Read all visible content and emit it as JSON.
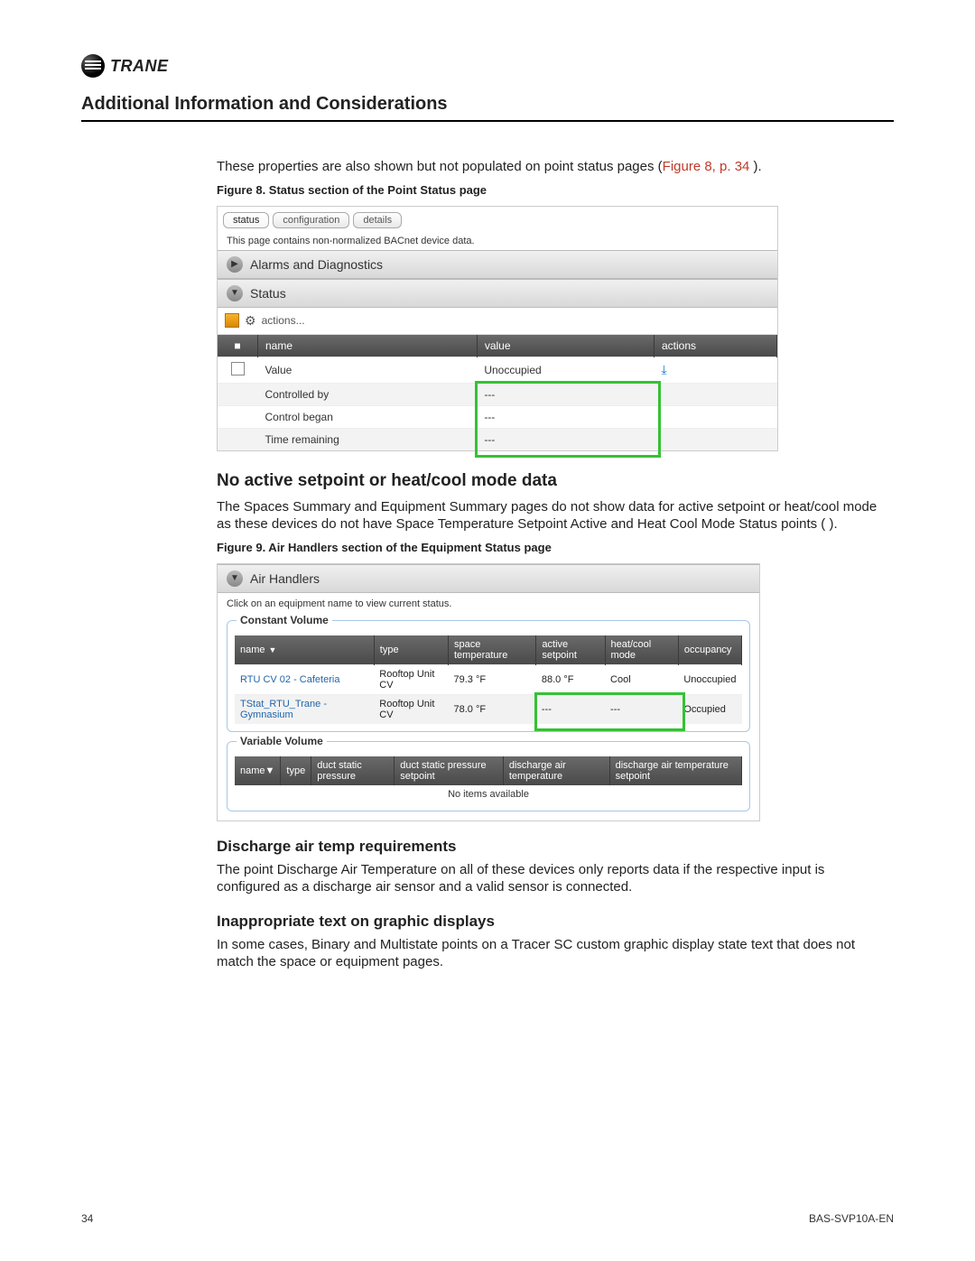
{
  "logo_text": "TRANE",
  "section_title": "Additional Information and Considerations",
  "intro_text": "These properties are also shown but not populated on point status pages (",
  "intro_link": "Figure 8, p. 34",
  "intro_tail": " ).",
  "fig8_caption": "Figure 8.   Status section of the Point Status page",
  "fig8": {
    "tabs": [
      "status",
      "configuration",
      "details"
    ],
    "note": "This page contains non-normalized BACnet device data.",
    "bar1": "Alarms and Diagnostics",
    "bar2": "Status",
    "actions_label": "actions...",
    "cols": {
      "c1": "",
      "c2": "name",
      "c3": "value",
      "c4": "actions"
    },
    "rows": [
      {
        "name": "Value",
        "value": "Unoccupied",
        "has_action": true,
        "has_chk": true
      },
      {
        "name": "Controlled by",
        "value": "---",
        "has_action": false,
        "has_chk": false
      },
      {
        "name": "Control began",
        "value": "---",
        "has_action": false,
        "has_chk": false
      },
      {
        "name": "Time remaining",
        "value": "---",
        "has_action": false,
        "has_chk": false
      }
    ]
  },
  "h2_no_active": "No active setpoint or heat/cool mode data",
  "p_no_active": "The Spaces Summary and Equipment Summary pages do not show data for active setpoint or heat/cool mode as these devices do not have Space Temperature Setpoint Active and Heat Cool Mode Status points ( ).",
  "fig9_caption": "Figure 9.   Air Handlers section of the Equipment Status page",
  "fig9": {
    "header": "Air Handlers",
    "hint": "Click on an equipment name to view current status.",
    "grp1": "Constant Volume",
    "cv_cols": [
      "name",
      "type",
      "space temperature",
      "active setpoint",
      "heat/cool mode",
      "occupancy"
    ],
    "cv_rows": [
      {
        "name": "RTU CV 02 - Cafeteria",
        "type": "Rooftop Unit CV",
        "space": "79.3 °F",
        "setpt": "88.0 °F",
        "mode": "Cool",
        "occ": "Unoccupied"
      },
      {
        "name": "TStat_RTU_Trane - Gymnasium",
        "type": "Rooftop Unit CV",
        "space": "78.0 °F",
        "setpt": "---",
        "mode": "---",
        "occ": "Occupied"
      }
    ],
    "grp2": "Variable Volume",
    "vv_cols": [
      "name",
      "type",
      "duct static pressure",
      "duct static pressure setpoint",
      "discharge air temperature",
      "discharge air temperature setpoint"
    ],
    "noitems": "No items available"
  },
  "h3_discharge": "Discharge air temp requirements",
  "p_discharge": "The point Discharge Air Temperature on all of these devices only reports data if the respective input is configured as a discharge air sensor and a valid sensor is connected.",
  "h3_inappropriate": "Inappropriate text on graphic displays",
  "p_inappropriate": "In some cases, Binary and Multistate points on a Tracer SC custom graphic display state text that does not match the space or equipment pages.",
  "footer_left": "34",
  "footer_right": "BAS-SVP10A-EN"
}
